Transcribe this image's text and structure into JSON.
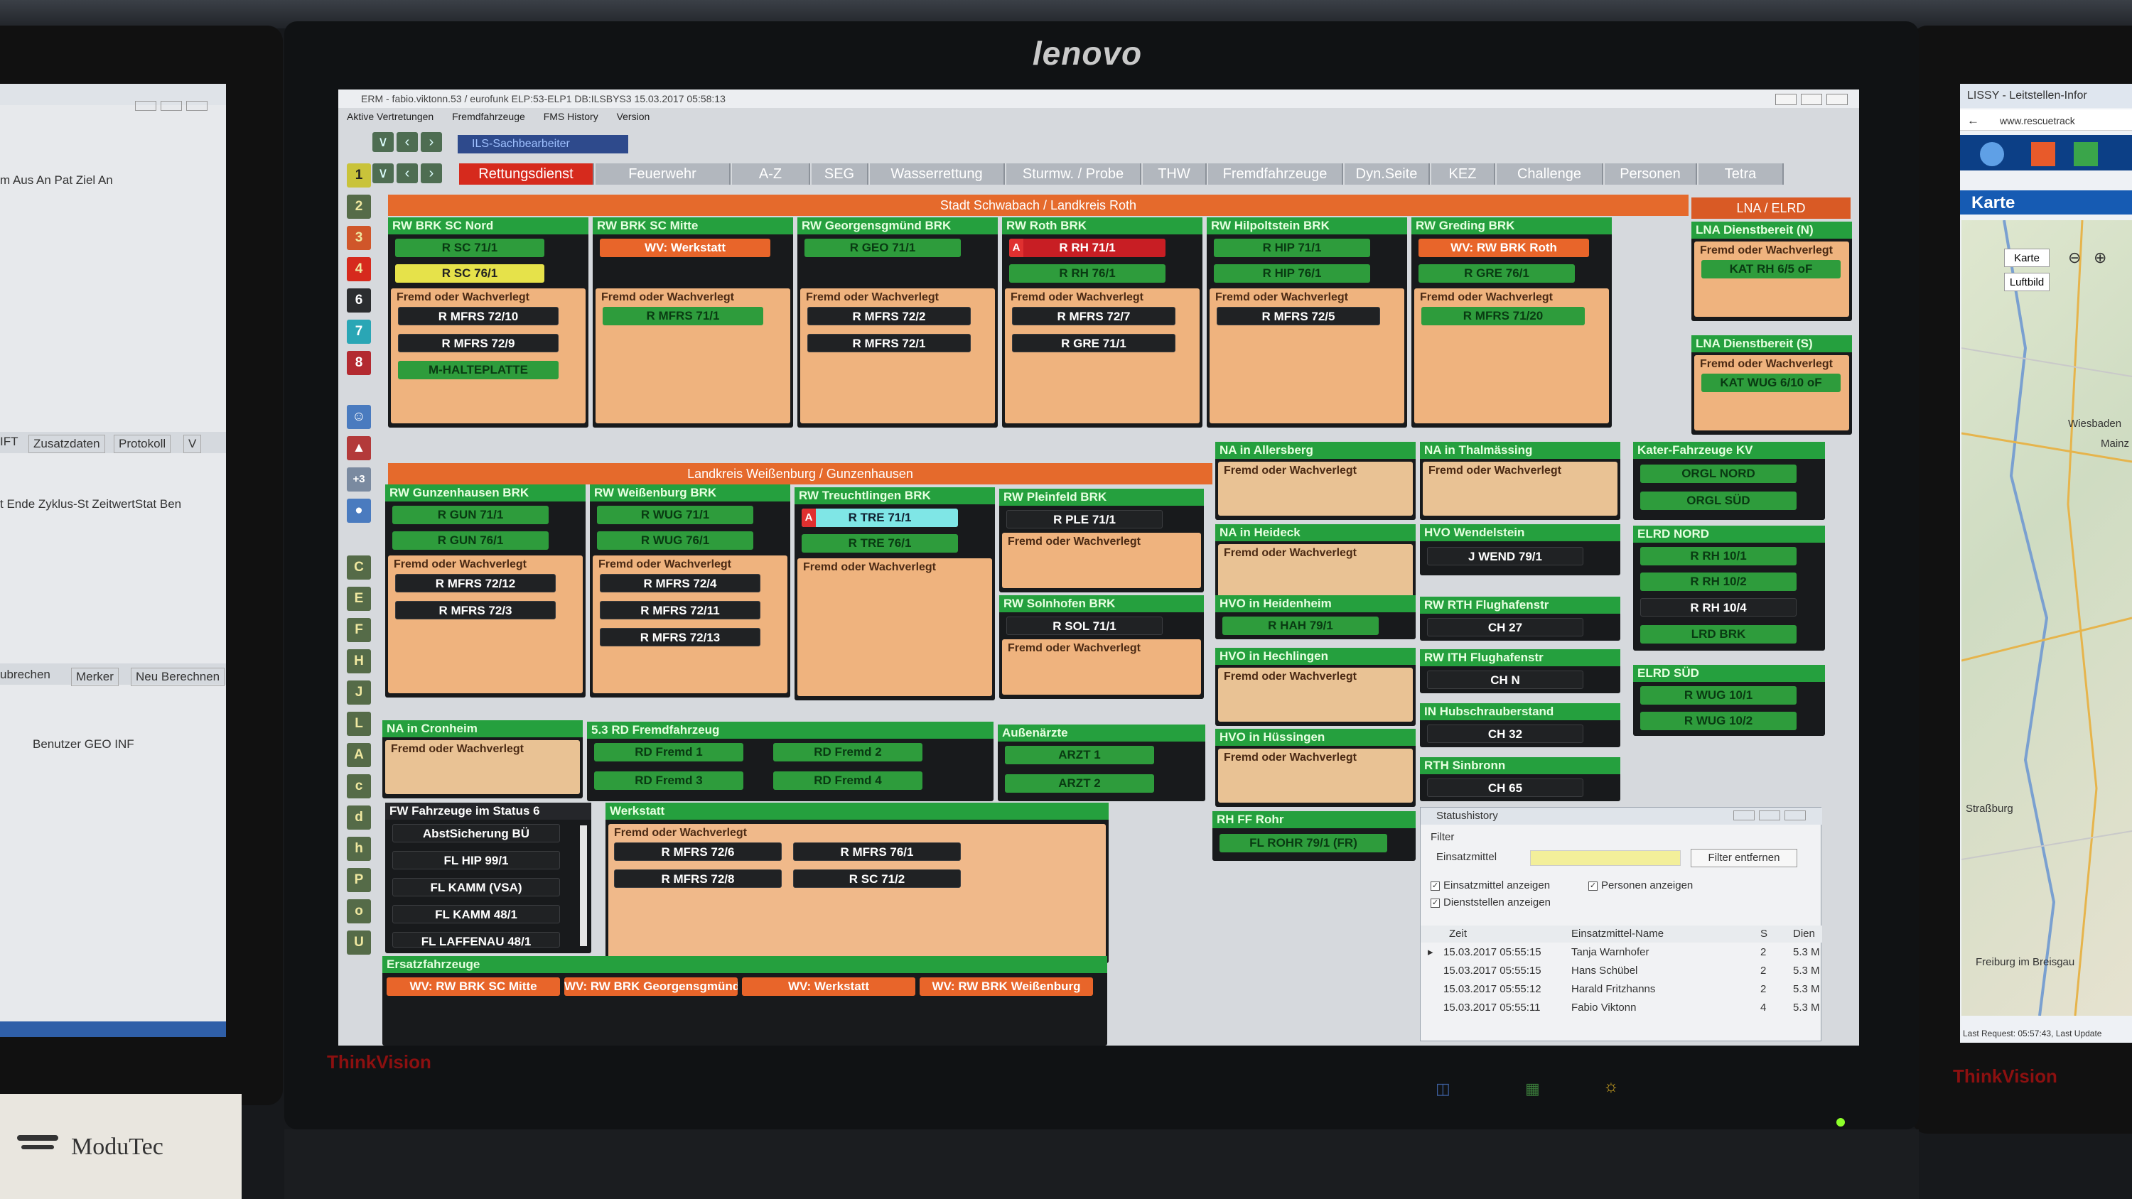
{
  "main_window": {
    "title": "ERM - fabio.viktonn.53 / eurofunk ELP:53-ELP1 DB:ILSBYS3 15.03.2017 05:58:13",
    "menu": [
      "Aktive Vertretungen",
      "Fremdfahrzeuge",
      "FMS History",
      "Version"
    ],
    "nav_field": "ILS-Sachbearbeiter",
    "tabs": [
      "Rettungsdienst",
      "Feuerwehr",
      "A-Z",
      "SEG",
      "Wasserrettung",
      "Sturmw. / Probe",
      "THW",
      "Fremdfahrzeuge",
      "Dyn.Seite",
      "KEZ",
      "Challenge",
      "Personen",
      "Tetra"
    ],
    "active_tab": "Rettungsdienst"
  },
  "sidebar": [
    "1",
    "2",
    "3",
    "4",
    "6",
    "7",
    "8",
    "C",
    "E",
    "F",
    "H",
    "J",
    "L",
    "A",
    "c",
    "d",
    "h",
    "P",
    "o",
    "U"
  ],
  "regions": {
    "schwabach": "Stadt Schwabach / Landkreis Roth",
    "lna": "LNA / ELRD",
    "weissenburg": "Landkreis Weißenburg / Gunzenhausen"
  },
  "fremd_label": "Fremd oder Wachverlegt",
  "panels": {
    "sc_nord": {
      "title": "RW BRK SC Nord",
      "v1": "R SC 71/1",
      "v2": "R SC 76/1",
      "f1": "R MFRS 72/10",
      "f2": "R MFRS 72/9",
      "f3": "M-HALTEPLATTE"
    },
    "sc_mitte": {
      "title": "RW BRK SC Mitte",
      "v1": "WV: Werkstatt",
      "f1": "R MFRS 71/1"
    },
    "georgensgmuend": {
      "title": "RW Georgensgmünd BRK",
      "v1": "R GEO 71/1",
      "f1": "R MFRS 72/2",
      "f2": "R MFRS 72/1"
    },
    "roth": {
      "title": "RW Roth BRK",
      "v1": "R RH 71/1",
      "v2": "R RH 76/1",
      "f1": "R MFRS 72/7",
      "f2": "R GRE 71/1"
    },
    "hilpoltstein": {
      "title": "RW Hilpoltstein BRK",
      "v1": "R HIP 71/1",
      "v2": "R HIP 76/1",
      "f1": "R MFRS 72/5"
    },
    "greding": {
      "title": "RW Greding BRK",
      "v1": "WV: RW BRK Roth",
      "v2": "R GRE 76/1",
      "f1": "R MFRS 71/20"
    },
    "lna_n": {
      "title": "LNA Dienstbereit (N)",
      "v1": "KAT RH 6/5 oF"
    },
    "lna_s": {
      "title": "LNA Dienstbereit (S)",
      "v1": "KAT WUG 6/10 oF"
    },
    "allersberg": {
      "title": "NA in Allersberg"
    },
    "thalmaessing": {
      "title": "NA in Thalmässing"
    },
    "kater": {
      "title": "Kater-Fahrzeuge KV",
      "v1": "ORGL NORD",
      "v2": "ORGL SÜD"
    },
    "gunzenhausen": {
      "title": "RW Gunzenhausen BRK",
      "v1": "R GUN 71/1",
      "v2": "R GUN 76/1",
      "f1": "R MFRS 72/12",
      "f2": "R MFRS 72/3"
    },
    "weissenburg": {
      "title": "RW Weißenburg BRK",
      "v1": "R WUG 71/1",
      "v2": "R WUG 76/1",
      "f1": "R MFRS 72/4",
      "f2": "R MFRS 72/11",
      "f3": "R MFRS 72/13"
    },
    "treuchtlingen": {
      "title": "RW Treuchtlingen BRK",
      "v1": "R TRE 71/1",
      "v2": "R TRE 76/1"
    },
    "pleinfeld": {
      "title": "RW Pleinfeld BRK",
      "v1": "R PLE 71/1"
    },
    "solnhofen": {
      "title": "RW Solnhofen BRK",
      "v1": "R SOL 71/1"
    },
    "heideck": {
      "title": "NA in Heideck"
    },
    "wendelstein": {
      "title": "HVO Wendelstein",
      "v1": "J WEND 79/1"
    },
    "elrd_nord": {
      "title": "ELRD NORD",
      "v1": "R RH 10/1",
      "v2": "R RH 10/2",
      "v3": "R RH 10/4",
      "v4": "LRD BRK"
    },
    "heidenheim": {
      "title": "HVO in Heidenheim",
      "v1": "R HAH 79/1"
    },
    "rth": {
      "title": "RW RTH Flughafenstr",
      "v1": "CH 27"
    },
    "hechlingen": {
      "title": "HVO in Hechlingen"
    },
    "ith": {
      "title": "RW ITH Flughafenstr",
      "v1": "CH N"
    },
    "elrd_sued": {
      "title": "ELRD SÜD",
      "v1": "R WUG 10/1",
      "v2": "R WUG 10/2"
    },
    "cronheim": {
      "title": "NA in Cronheim"
    },
    "fremdfahrzeug": {
      "title": "5.3 RD Fremdfahrzeug",
      "v1": "RD Fremd 1",
      "v2": "RD Fremd 2",
      "v3": "RD Fremd 3",
      "v4": "RD Fremd 4"
    },
    "aussen": {
      "title": "Außenärzte",
      "v1": "ARZT 1",
      "v2": "ARZT 2"
    },
    "huessingen": {
      "title": "HVO in Hüssingen"
    },
    "hubschrauber": {
      "title": "IN Hubschrauberstand",
      "v1": "CH 32"
    },
    "sinbronn": {
      "title": "RTH Sinbronn",
      "v1": "CH 65"
    },
    "status6": {
      "title": "FW Fahrzeuge im Status 6",
      "v1": "AbstSicherung BÜ",
      "v2": "FL HIP 99/1",
      "v3": "FL KAMM (VSA)",
      "v4": "FL KAMM 48/1",
      "v5": "FL LAFFENAU 48/1"
    },
    "werkstatt": {
      "title": "Werkstatt",
      "f1": "R MFRS 72/6",
      "f2": "R MFRS 76/1",
      "f3": "R MFRS 72/8",
      "f4": "R SC 71/2"
    },
    "ff_rohr": {
      "title": "RH FF Rohr",
      "v1": "FL ROHR 79/1 (FR)"
    },
    "ersatz": {
      "title": "Ersatzfahrzeuge",
      "v1": "WV: RW BRK SC Mitte",
      "v2": "WV: RW BRK Georgensgmünd",
      "v3": "WV: Werkstatt",
      "v4": "WV: RW BRK Weißenburg"
    }
  },
  "statushistory": {
    "title": "Statushistory",
    "filter_label": "Filter",
    "einsatzmittel_label": "Einsatzmittel",
    "filter_button": "Filter entfernen",
    "cb1": "Einsatzmittel anzeigen",
    "cb2": "Personen anzeigen",
    "cb3": "Dienststellen anzeigen",
    "columns": [
      "Zeit",
      "Einsatzmittel-Name",
      "S",
      "Dien"
    ],
    "rows": [
      [
        "15.03.2017 05:55:15",
        "Tanja Warnhofer",
        "2",
        "5.3 M"
      ],
      [
        "15.03.2017 05:55:15",
        "Hans Schübel",
        "2",
        "5.3 M"
      ],
      [
        "15.03.2017 05:55:12",
        "Harald Fritzhanns",
        "2",
        "5.3 M"
      ],
      [
        "15.03.2017 05:55:11",
        "Fabio Viktonn",
        "4",
        "5.3 M"
      ]
    ]
  },
  "left_window": {
    "cols": "m   Aus   An   Pat   Ziel An",
    "btns": [
      "IFT",
      "Zusatzdaten",
      "Protokoll",
      "V"
    ],
    "cols2": "t   Ende  Zyklus-St  ZeitwertStat  Ben",
    "btns2": [
      "ubrechen",
      "Merker",
      "Neu Berechnen"
    ],
    "cols3": "Benutzer   GEO  INF"
  },
  "right_window": {
    "title": "LISSY - Leitstellen-Infor",
    "url": "www.rescuetrack",
    "karte": "Karte",
    "karte_btn": "Karte",
    "luftbild": "Luftbild",
    "footer": "Last Request: 05:57:43, Last Update",
    "towns": [
      "Wiesbaden",
      "Mainz",
      "Straßburg",
      "Freiburg im Breisgau"
    ]
  },
  "brands": {
    "monitor": "lenovo",
    "bezel": "ThinkVision",
    "bezel_right": "ThinkVision",
    "desk_label": "ModuTec"
  }
}
